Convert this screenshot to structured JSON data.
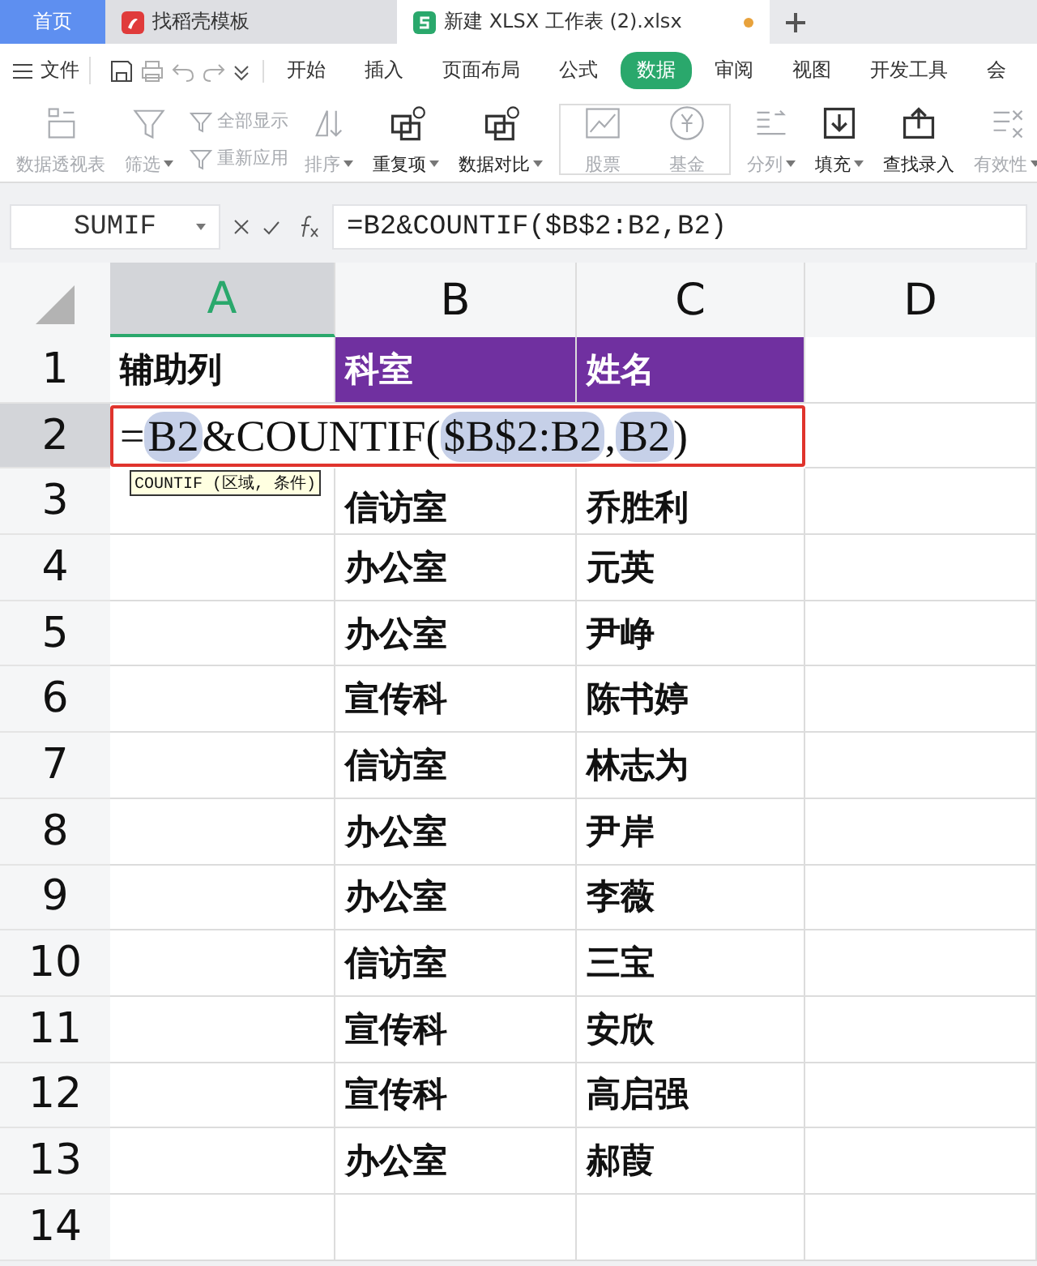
{
  "tabs": [
    {
      "kind": "home",
      "label": "首页",
      "selected": false
    },
    {
      "kind": "template",
      "label": "找稻壳模板",
      "selected": false
    },
    {
      "kind": "sheet",
      "label": "新建 XLSX 工作表 (2).xlsx",
      "selected": true,
      "unsaved": true
    }
  ],
  "menu": {
    "file": "文件",
    "tabs": [
      {
        "label": "开始",
        "selected": false
      },
      {
        "label": "插入",
        "selected": false
      },
      {
        "label": "页面布局",
        "selected": false
      },
      {
        "label": "公式",
        "selected": false
      },
      {
        "label": "数据",
        "selected": true
      },
      {
        "label": "审阅",
        "selected": false
      },
      {
        "label": "视图",
        "selected": false
      },
      {
        "label": "开发工具",
        "selected": false
      },
      {
        "label": "会",
        "selected": false
      }
    ]
  },
  "ribbon": [
    {
      "kind": "large",
      "label": "数据透视表",
      "disabled": true,
      "dropdown": false
    },
    {
      "kind": "large",
      "label": "筛选",
      "disabled": true,
      "dropdown": true
    },
    {
      "kind": "stack",
      "items": [
        {
          "label": "全部显示",
          "disabled": true
        },
        {
          "label": "重新应用",
          "disabled": true
        }
      ]
    },
    {
      "kind": "large",
      "label": "排序",
      "disabled": true,
      "dropdown": true
    },
    {
      "kind": "large",
      "label": "重复项",
      "disabled": false,
      "dropdown": true
    },
    {
      "kind": "large",
      "label": "数据对比",
      "disabled": false,
      "dropdown": true
    },
    {
      "kind": "gallery",
      "items": [
        {
          "label": "股票",
          "disabled": true
        },
        {
          "label": "基金",
          "disabled": true
        }
      ]
    },
    {
      "kind": "large",
      "label": "分列",
      "disabled": true,
      "dropdown": true
    },
    {
      "kind": "large",
      "label": "填充",
      "disabled": false,
      "dropdown": true
    },
    {
      "kind": "large",
      "label": "查找录入",
      "disabled": false,
      "dropdown": false
    },
    {
      "kind": "large",
      "label": "有效性",
      "disabled": true,
      "dropdown": true
    }
  ],
  "formula_bar": {
    "name_box": "SUMIF",
    "formula": "=B2&COUNTIF($B$2:B2,B2)"
  },
  "columns": [
    {
      "label": "A",
      "selected": true
    },
    {
      "label": "B",
      "selected": false
    },
    {
      "label": "C",
      "selected": false
    },
    {
      "label": "D",
      "selected": false
    }
  ],
  "rows": [
    {
      "number": "1",
      "kind": "header",
      "selected": false,
      "cells": [
        "辅助列",
        "科室",
        "姓名"
      ]
    },
    {
      "number": "2",
      "kind": "editing",
      "selected": true,
      "parts": [
        {
          "kind": "text",
          "text": "="
        },
        {
          "kind": "ref",
          "text": "B2"
        },
        {
          "kind": "text",
          "text": "&COUNTIF("
        },
        {
          "kind": "ref",
          "text": "$B$2:B2"
        },
        {
          "kind": "text",
          "text": ","
        },
        {
          "kind": "ref",
          "text": "B2"
        },
        {
          "kind": "text",
          "text": ")"
        }
      ]
    },
    {
      "number": "3",
      "kind": "data",
      "selected": false,
      "cells": [
        "",
        "信访室",
        "乔胜利"
      ],
      "tooltip": "COUNTIF (区域, 条件)"
    },
    {
      "number": "4",
      "kind": "data",
      "selected": false,
      "cells": [
        "",
        "办公室",
        "元英"
      ]
    },
    {
      "number": "5",
      "kind": "data",
      "selected": false,
      "cells": [
        "",
        "办公室",
        "尹峥"
      ]
    },
    {
      "number": "6",
      "kind": "data",
      "selected": false,
      "cells": [
        "",
        "宣传科",
        "陈书婷"
      ]
    },
    {
      "number": "7",
      "kind": "data",
      "selected": false,
      "cells": [
        "",
        "信访室",
        "林志为"
      ]
    },
    {
      "number": "8",
      "kind": "data",
      "selected": false,
      "cells": [
        "",
        "办公室",
        "尹岸"
      ]
    },
    {
      "number": "9",
      "kind": "data",
      "selected": false,
      "cells": [
        "",
        "办公室",
        "李薇"
      ]
    },
    {
      "number": "10",
      "kind": "data",
      "selected": false,
      "cells": [
        "",
        "信访室",
        "三宝"
      ]
    },
    {
      "number": "11",
      "kind": "data",
      "selected": false,
      "cells": [
        "",
        "宣传科",
        "安欣"
      ]
    },
    {
      "number": "12",
      "kind": "data",
      "selected": false,
      "cells": [
        "",
        "宣传科",
        "高启强"
      ]
    },
    {
      "number": "13",
      "kind": "data",
      "selected": false,
      "cells": [
        "",
        "办公室",
        "郝葭"
      ]
    },
    {
      "number": "14",
      "kind": "data",
      "selected": false,
      "cells": [
        "",
        "",
        ""
      ]
    }
  ]
}
